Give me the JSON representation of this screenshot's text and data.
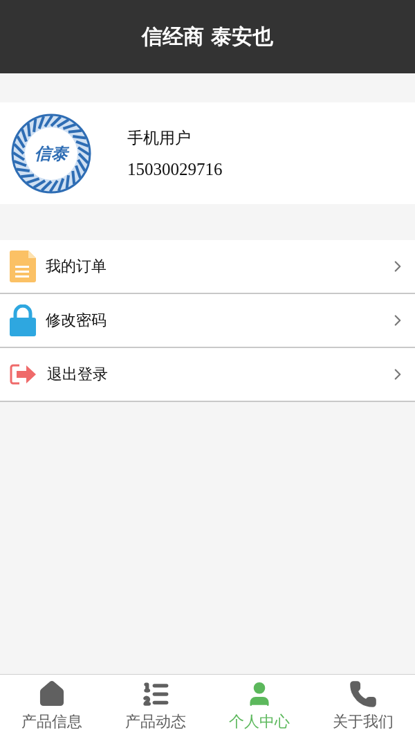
{
  "header": {
    "title": "信经商 泰安也"
  },
  "profile": {
    "logo_text": "信泰",
    "name": "手机用户",
    "phone": "15030029716"
  },
  "menu": [
    {
      "label": "我的订单"
    },
    {
      "label": "修改密码"
    },
    {
      "label": "退出登录"
    }
  ],
  "tab_bar": [
    {
      "label": "产品信息",
      "selected": false
    },
    {
      "label": "产品动态",
      "selected": false
    },
    {
      "label": "个人中心",
      "selected": true
    },
    {
      "label": "关于我们",
      "selected": false
    }
  ]
}
